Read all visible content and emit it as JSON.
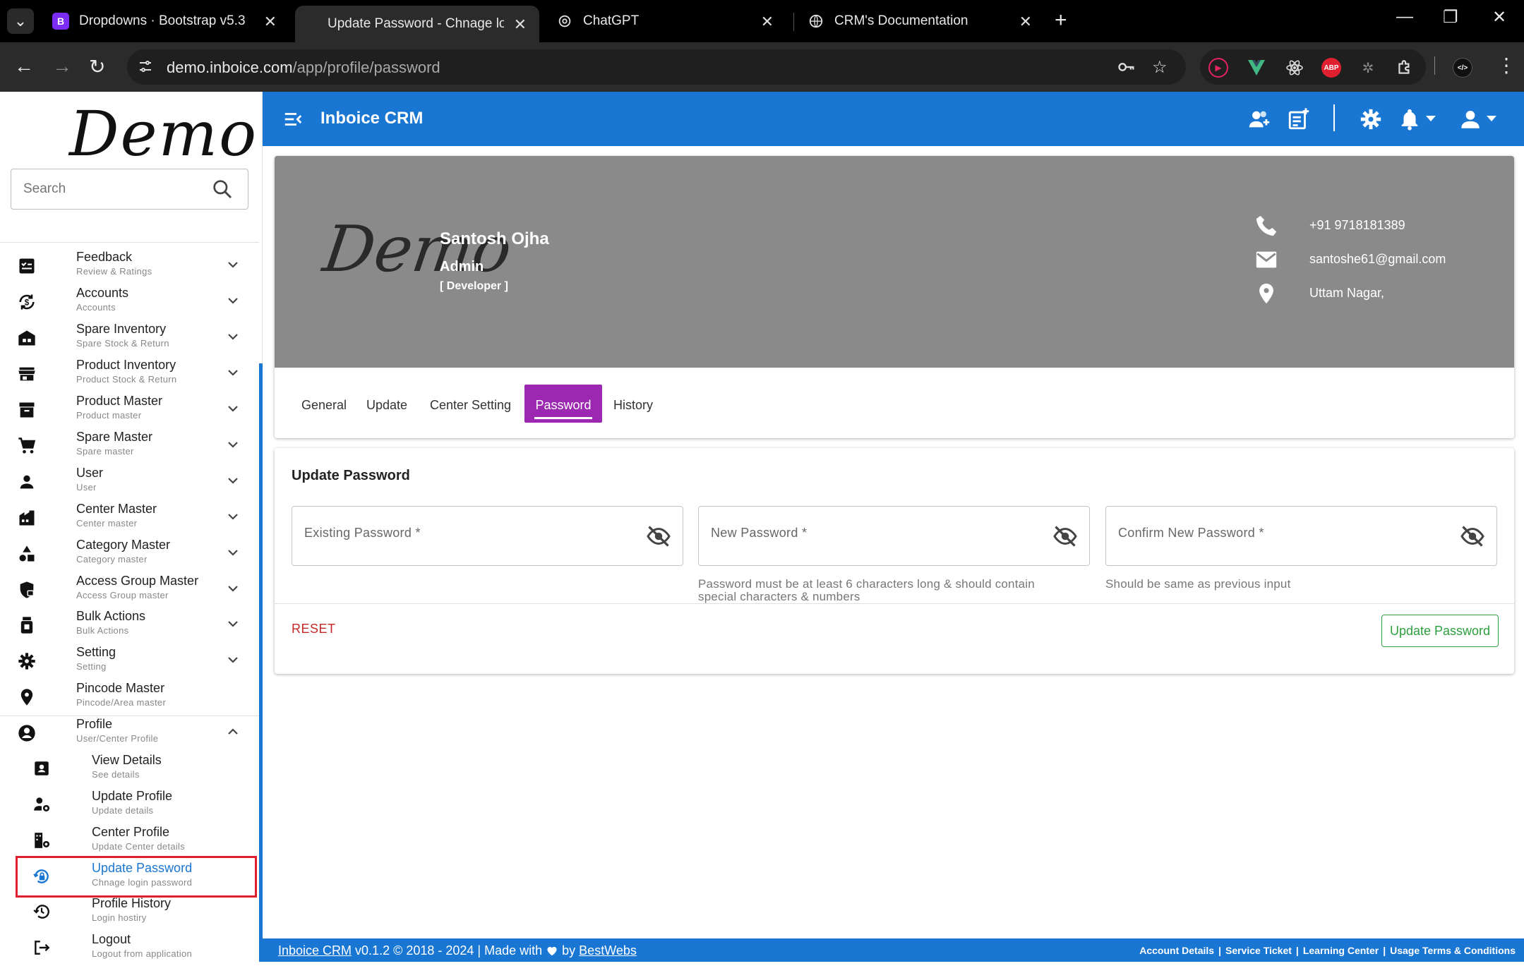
{
  "browser": {
    "tabs": [
      {
        "title": "Dropdowns · Bootstrap v5.3",
        "favicon": "bootstrap-icon",
        "active": false
      },
      {
        "title": "Update Password - Chnage logi",
        "favicon": "",
        "active": true
      },
      {
        "title": "ChatGPT",
        "favicon": "chatgpt-icon",
        "active": false
      },
      {
        "title": "CRM's Documentation",
        "favicon": "globe-icon",
        "active": false
      }
    ],
    "url_host": "demo.inboice.com",
    "url_path": "/app/profile/password",
    "extensions": [
      "ext-red-play",
      "ext-vue",
      "ext-react",
      "ext-abp",
      "ext-bug",
      "extensions-puzzle",
      "ext-devtools"
    ],
    "abp_label": "ABP",
    "dev_label": "</>"
  },
  "sidebar": {
    "logo": "Demo",
    "search_placeholder": "Search",
    "items": [
      {
        "label": "Feedback",
        "sub": "Review & Ratings",
        "icon": "feedback-icon"
      },
      {
        "label": "Accounts",
        "sub": "Accounts",
        "icon": "accounts-sync-icon"
      },
      {
        "label": "Spare Inventory",
        "sub": "Spare Stock & Return",
        "icon": "warehouse-icon"
      },
      {
        "label": "Product Inventory",
        "sub": "Product Stock & Return",
        "icon": "store-icon"
      },
      {
        "label": "Product Master",
        "sub": "Product master",
        "icon": "archive-icon"
      },
      {
        "label": "Spare Master",
        "sub": "Spare master",
        "icon": "cart-icon"
      },
      {
        "label": "User",
        "sub": "User",
        "icon": "person-icon"
      },
      {
        "label": "Center Master",
        "sub": "Center master",
        "icon": "building-icon"
      },
      {
        "label": "Category Master",
        "sub": "Category master",
        "icon": "category-icon"
      },
      {
        "label": "Access Group Master",
        "sub": "Access Group master",
        "icon": "shield-lock-icon"
      },
      {
        "label": "Bulk Actions",
        "sub": "Bulk Actions",
        "icon": "bulk-icon"
      },
      {
        "label": "Setting",
        "sub": "Setting",
        "icon": "gear-icon"
      },
      {
        "label": "Pincode Master",
        "sub": "Pincode/Area master",
        "icon": "location-icon"
      },
      {
        "label": "Profile",
        "sub": "User/Center Profile",
        "icon": "account-circle-icon"
      }
    ],
    "profile_children": [
      {
        "label": "View Details",
        "sub": "See details",
        "icon": "badge-icon"
      },
      {
        "label": "Update Profile",
        "sub": "Update details",
        "icon": "manage-account-icon"
      },
      {
        "label": "Center Profile",
        "sub": "Update Center details",
        "icon": "building-gear-icon"
      },
      {
        "label": "Update Password",
        "sub": "Chnage login password",
        "icon": "lock-reset-icon",
        "active": true
      },
      {
        "label": "Profile History",
        "sub": "Login hostiry",
        "icon": "history-icon"
      },
      {
        "label": "Logout",
        "sub": "Logout from application",
        "icon": "logout-icon"
      }
    ]
  },
  "header": {
    "app_title": "Inboice CRM"
  },
  "profile": {
    "logo_text": "Demo",
    "name": "Santosh Ojha",
    "role": "Admin",
    "designation": "[ Developer ]",
    "phone": "+91 9718181389",
    "email": "santoshe61@gmail.com",
    "address": "Uttam Nagar,",
    "tabs": [
      "General",
      "Update",
      "Center Setting",
      "Password",
      "History"
    ],
    "active_tab": "Password"
  },
  "form": {
    "title": "Update Password",
    "existing_placeholder": "Existing Password *",
    "new_placeholder": "New Password *",
    "confirm_placeholder": "Confirm New Password *",
    "new_helper_1": "Password must be at least 6 characters long & should contain",
    "new_helper_2": "special characters & numbers",
    "confirm_helper": "Should be same as previous input",
    "reset_label": "RESET",
    "submit_label": "Update Password"
  },
  "footer": {
    "brand": "Inboice CRM",
    "version_text": " v0.1.2 © 2018 - 2024 | Made with ",
    "by_text": " by ",
    "company": "BestWebs",
    "links": [
      "Account Details",
      "Service Ticket",
      "Learning Center",
      "Usage Terms & Conditions"
    ]
  },
  "colors": {
    "primary": "#1976d2",
    "tab_active": "#9c27b0",
    "banner": "#8a8a8a",
    "reset": "#c62828",
    "submit": "#2e9e3e",
    "highlight_box": "#e0202f"
  }
}
